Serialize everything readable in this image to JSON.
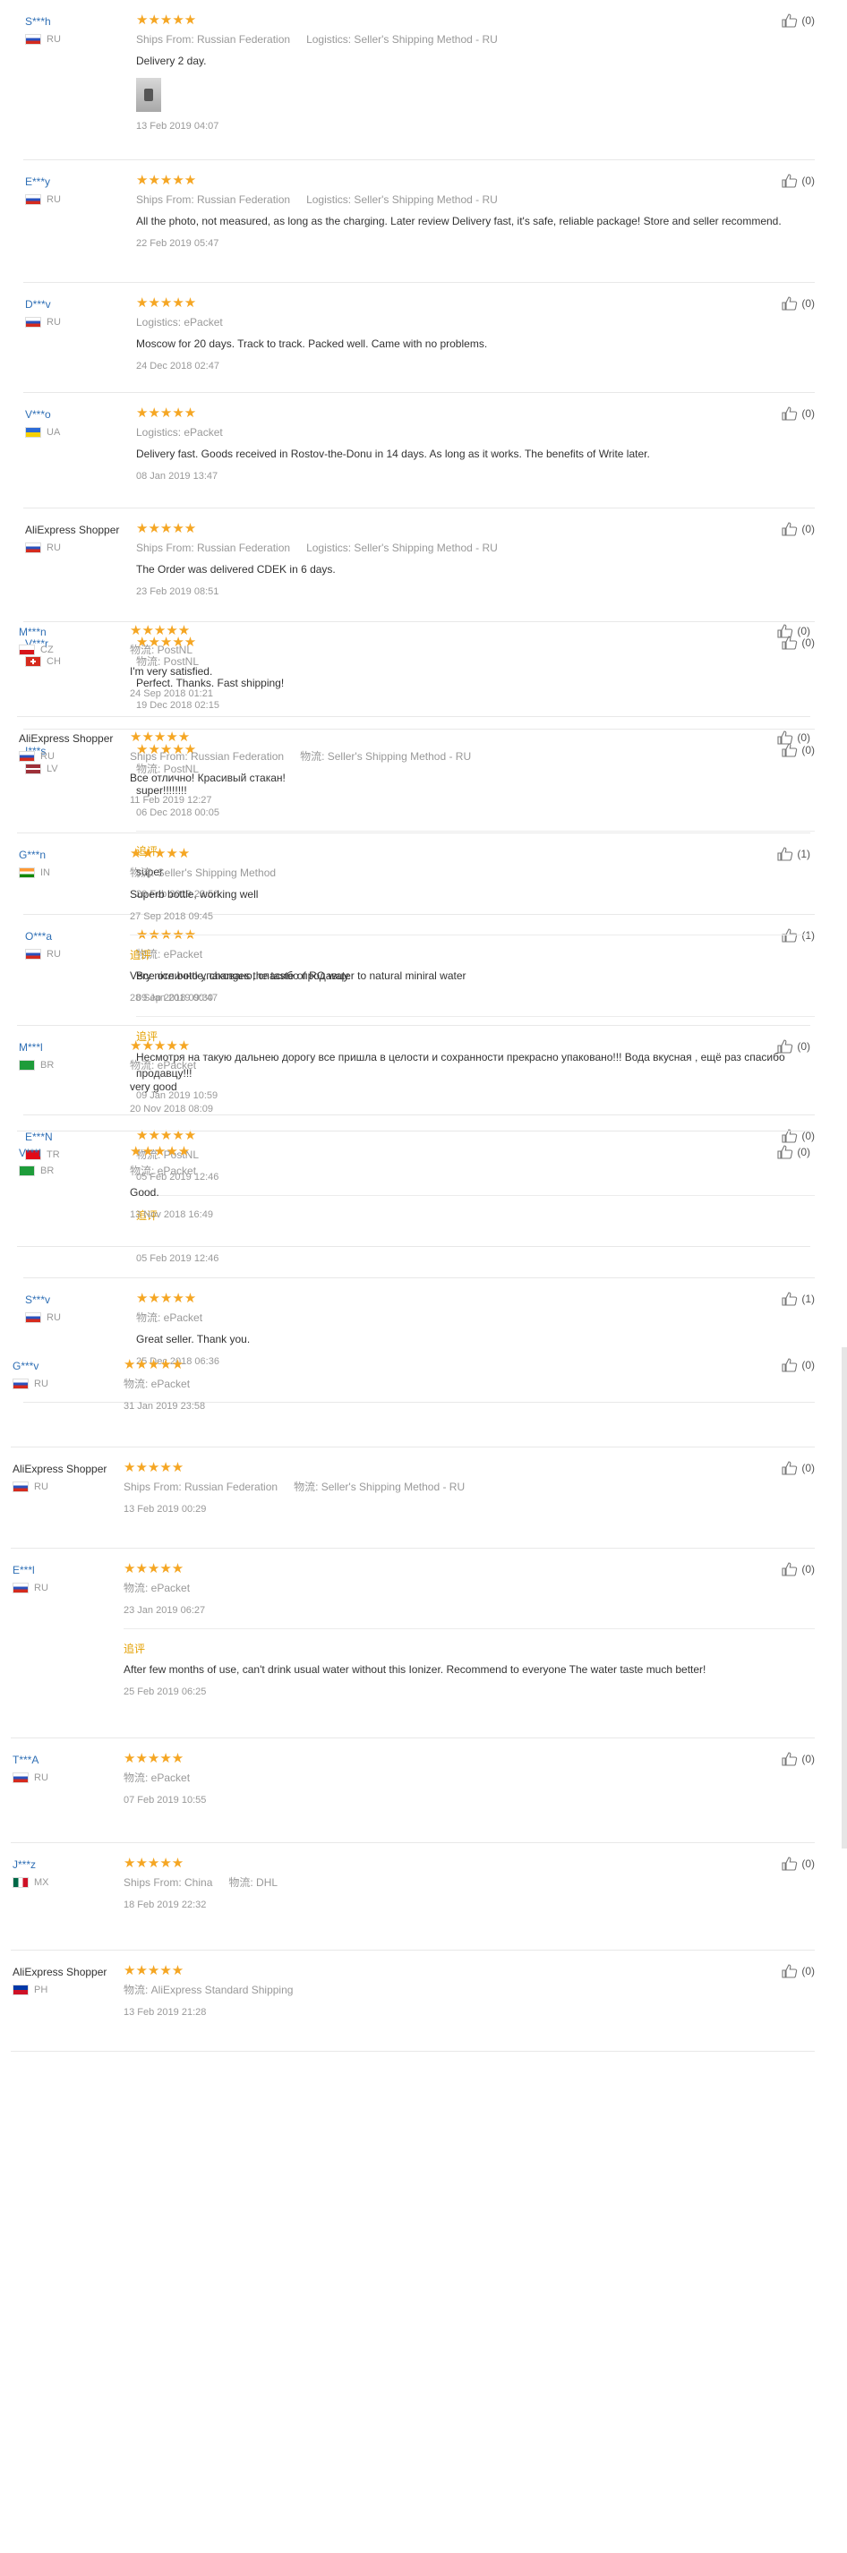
{
  "labels": {
    "append": "追评"
  },
  "reviews": [
    {
      "name": "S***h",
      "country": "RU",
      "flag": "ru",
      "meta1": "Ships From: Russian Federation",
      "meta2": "Logistics: Seller's Shipping Method - RU",
      "text": "Delivery 2 day.",
      "photo": true,
      "date": "13 Feb 2019 04:07",
      "likes": "(0)"
    },
    {
      "name": "E***y",
      "country": "RU",
      "flag": "ru",
      "meta1": "Ships From: Russian Federation",
      "meta2": "Logistics: Seller's Shipping Method - RU",
      "text": "All the photo, not measured, as long as the charging. Later review Delivery fast, it's safe, reliable package! Store and seller recommend.",
      "date": "22 Feb 2019 05:47",
      "likes": "(0)"
    },
    {
      "name": "D***v",
      "country": "RU",
      "flag": "ru",
      "meta1": "Logistics: ePacket",
      "text": "Moscow for 20 days. Track to track. Packed well. Came with no problems.",
      "date": "24 Dec 2018 02:47",
      "likes": "(0)"
    },
    {
      "name": "V***o",
      "country": "UA",
      "flag": "ua",
      "meta1": "Logistics: ePacket",
      "text": "Delivery fast. Goods received in Rostov-the-Donu in 14 days. As long as it works. The benefits of Write later.",
      "date": "08 Jan 2019 13:47",
      "likes": "(0)"
    },
    {
      "name": "AliExpress Shopper",
      "plain": true,
      "country": "RU",
      "flag": "ru",
      "meta1": "Ships From: Russian Federation",
      "meta2": "Logistics: Seller's Shipping Method - RU",
      "text": "The Order was delivered CDEK in 6 days.",
      "date": "23 Feb 2019 08:51",
      "likes": "(0)"
    },
    {
      "name": "V***r",
      "country": "CH",
      "flag": "ch",
      "meta1": "物流: PostNL",
      "text": "Perfect. Thanks. Fast shipping!",
      "date": "19 Dec 2018 02:15",
      "likes": "(0)"
    },
    {
      "name": "I***s",
      "country": "LV",
      "flag": "lv",
      "meta1": "物流: PostNL",
      "text": "super!!!!!!!!",
      "date": "06 Dec 2018 00:05",
      "append": {
        "text": "super",
        "date": "20 Feb 2019 23:50"
      },
      "likes": "(0)"
    },
    {
      "name": "O***a",
      "country": "RU",
      "flag": "ru",
      "meta1": "物流: ePacket",
      "text": "Все отлично упаковано, спасибо продавцу.",
      "date": "09 Jan 2019 00:47",
      "append": {
        "text": "Несмотря на такую дальнею дорогу все пришла в целости и сохранности прекрасно упаковано!!! Вода вкусная , ещё раз спасибо продавцу!!!",
        "date": "09 Jan 2019 10:59"
      },
      "likes": "(1)"
    },
    {
      "name": "E***N",
      "country": "TR",
      "flag": "tr",
      "meta1": "物流: PostNL",
      "text": "",
      "date": "05 Feb 2019 12:46",
      "append": {
        "text": "",
        "date": "05 Feb 2019 12:46"
      },
      "likes": "(0)"
    },
    {
      "name": "S***v",
      "country": "RU",
      "flag": "ru",
      "meta1": "物流: ePacket",
      "text": "Great seller. Thank you.",
      "date": "25 Dec 2018 06:36",
      "likes": "(1)"
    }
  ],
  "reviews2": [
    {
      "name": "M***n",
      "country": "CZ",
      "flag": "cz",
      "meta1": "物流: PostNL",
      "text": "I'm very satisfied.",
      "date": "24 Sep 2018 01:21",
      "likes": "(0)"
    },
    {
      "name": "AliExpress Shopper",
      "plain": true,
      "country": "RU",
      "flag": "ru",
      "meta1": "Ships From: Russian Federation",
      "meta2": "物流: Seller's Shipping Method - RU",
      "text": "Все отлично! Красивый стакан!",
      "date": "11 Feb 2019 12:27",
      "likes": "(0)"
    },
    {
      "name": "G***n",
      "country": "IN",
      "flag": "in",
      "meta1": "物流: Seller's Shipping Method",
      "text": "Superb bottle, working well",
      "date": "27 Sep 2018 09:45",
      "append": {
        "text": "Very nice bottle, changes the taste of RO water to natural miniral water",
        "date": "28 Sep 2018 09:30"
      },
      "likes": "(1)"
    },
    {
      "name": "M***l",
      "country": "BR",
      "flag": "br",
      "meta1": "物流: ePacket",
      "text": "very good",
      "date": "20 Nov 2018 08:09",
      "likes": "(0)"
    },
    {
      "name": "V***l",
      "country": "BR",
      "flag": "br",
      "meta1": "物流: ePacket",
      "text": "Good.",
      "date": "13 Nov 2018 16:49",
      "likes": "(0)"
    }
  ],
  "reviews3": [
    {
      "name": "G***v",
      "country": "RU",
      "flag": "ru",
      "meta1": "物流: ePacket",
      "text": "",
      "date": "31 Jan 2019 23:58",
      "likes": "(0)"
    },
    {
      "name": "AliExpress Shopper",
      "plain": true,
      "country": "RU",
      "flag": "ru",
      "meta1": "Ships From: Russian Federation",
      "meta2": "物流: Seller's Shipping Method - RU",
      "text": "",
      "date": "13 Feb 2019 00:29",
      "likes": "(0)"
    },
    {
      "name": "E***l",
      "country": "RU",
      "flag": "ru",
      "meta1": "物流: ePacket",
      "text": "",
      "date": "23 Jan 2019 06:27",
      "append": {
        "text": "After few months of use, can't drink usual water without this Ionizer. Recommend to everyone The water taste much better!",
        "date": "25 Feb 2019 06:25"
      },
      "likes": "(0)"
    },
    {
      "name": "T***A",
      "country": "RU",
      "flag": "ru",
      "meta1": "物流: ePacket",
      "text": "",
      "date": "07 Feb 2019 10:55",
      "likes": "(0)"
    },
    {
      "name": "J***z",
      "country": "MX",
      "flag": "mx",
      "meta1": "Ships From: China",
      "meta2": "物流: DHL",
      "text": "",
      "date": "18 Feb 2019 22:32",
      "likes": "(0)"
    },
    {
      "name": "AliExpress Shopper",
      "plain": true,
      "country": "PH",
      "flag": "ph",
      "meta1": "物流: AliExpress Standard Shipping",
      "text": "",
      "date": "13 Feb 2019 21:28",
      "likes": "(0)"
    }
  ]
}
